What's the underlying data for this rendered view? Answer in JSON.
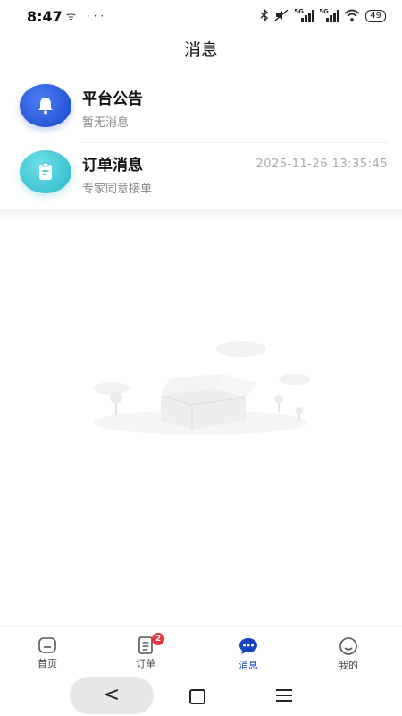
{
  "status_bar": {
    "time": "8:47",
    "left_icons": "ᯤ ···",
    "bluetooth_icon": "bluetooth-icon",
    "network_1": "5G",
    "network_2": "5G",
    "battery": "49"
  },
  "header": {
    "title": "消息"
  },
  "messages": [
    {
      "title": "平台公告",
      "subtitle": "暂无消息",
      "time": "",
      "icon": "bell-icon",
      "color": "#1f52d6"
    },
    {
      "title": "订单消息",
      "subtitle": "专家同意接单",
      "time": "2025-11-26 13:35:45",
      "icon": "clipboard-icon",
      "color": "#3cc2d2"
    }
  ],
  "tabbar": {
    "tabs": [
      {
        "label": "首页",
        "icon": "home-icon",
        "active": false
      },
      {
        "label": "订单",
        "icon": "order-icon",
        "badge": "2",
        "active": false
      },
      {
        "label": "消息",
        "icon": "message-icon",
        "active": true
      },
      {
        "label": "我的",
        "icon": "profile-icon",
        "active": false
      }
    ],
    "accent": "#1a43c2"
  },
  "navbar": {
    "back_glyph": "<"
  }
}
